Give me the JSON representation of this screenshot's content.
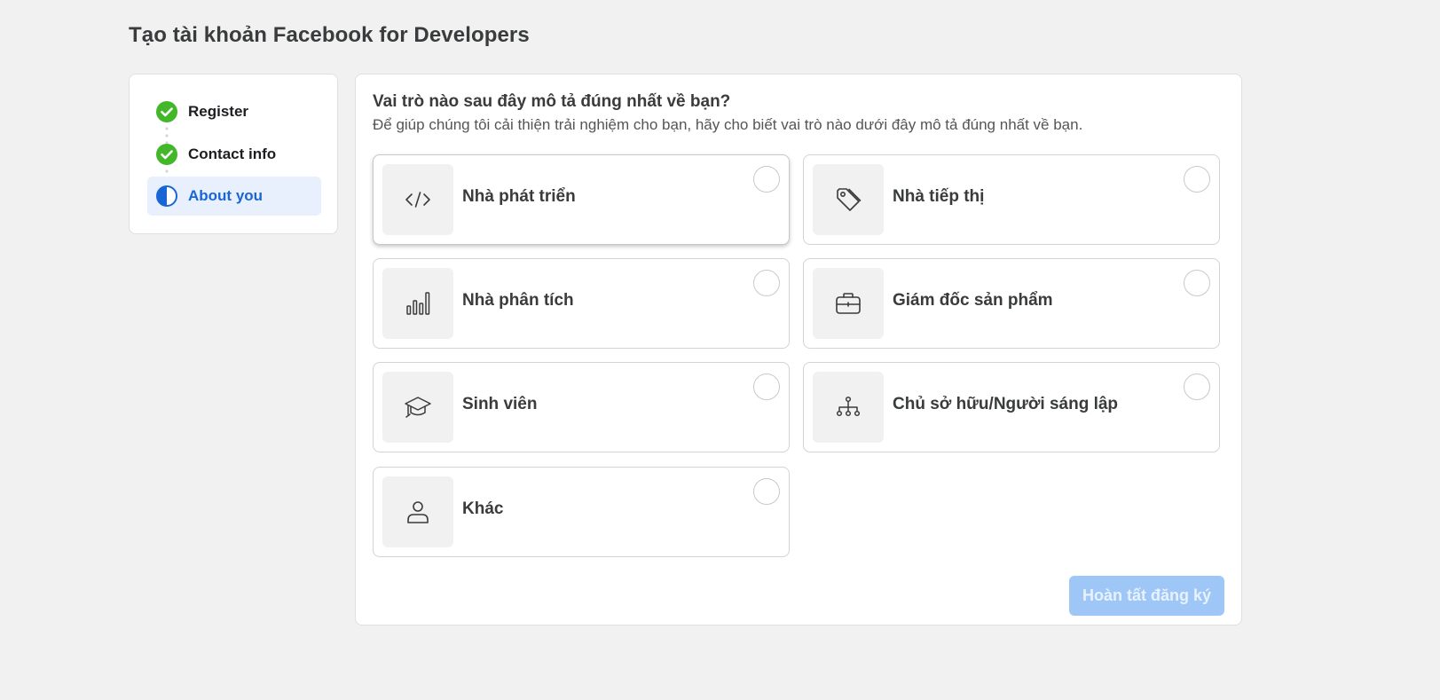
{
  "page": {
    "title": "Tạo tài khoản Facebook for Developers"
  },
  "steps": [
    {
      "label": "Register",
      "status": "complete",
      "icon": "check-circle-icon"
    },
    {
      "label": "Contact info",
      "status": "complete",
      "icon": "check-circle-icon"
    },
    {
      "label": "About you",
      "status": "current",
      "icon": "half-circle-icon"
    }
  ],
  "question": {
    "title": "Vai trò nào sau đây mô tả đúng nhất về bạn?",
    "subtitle": "Để giúp chúng tôi cải thiện trải nghiệm cho bạn, hãy cho biết vai trò nào dưới đây mô tả đúng nhất về bạn."
  },
  "options": [
    {
      "label": "Nhà phát triển",
      "icon": "code-icon",
      "selected": false
    },
    {
      "label": "Nhà tiếp thị",
      "icon": "tag-icon",
      "selected": false
    },
    {
      "label": "Nhà phân tích",
      "icon": "bar-chart-icon",
      "selected": false
    },
    {
      "label": "Giám đốc sản phẩm",
      "icon": "briefcase-icon",
      "selected": false
    },
    {
      "label": "Sinh viên",
      "icon": "graduation-cap-icon",
      "selected": false
    },
    {
      "label": "Chủ sở hữu/Người sáng lập",
      "icon": "org-chart-icon",
      "selected": false
    },
    {
      "label": "Khác",
      "icon": "person-icon",
      "selected": false
    }
  ],
  "submit": {
    "label": "Hoàn tất đăng ký",
    "enabled": false
  },
  "colors": {
    "accent": "#1a65d6",
    "complete": "#42b72a",
    "current_step_bg": "#e7f0fc",
    "button_disabled_bg": "#9ec7f7",
    "page_bg": "#f1f1f1"
  }
}
